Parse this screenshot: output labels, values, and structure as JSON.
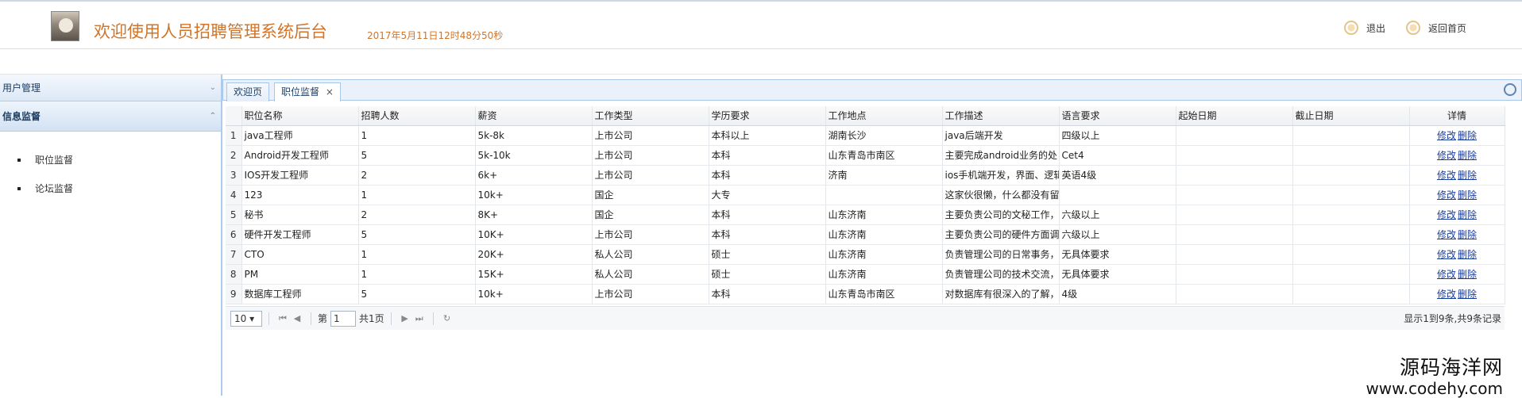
{
  "header": {
    "title": "欢迎使用人员招聘管理系统后台",
    "datetime": "2017年5月11日12时48分50秒",
    "logout_label": "退出",
    "home_label": "返回首页"
  },
  "sidebar": {
    "sections": [
      {
        "label": "用户管理"
      },
      {
        "label": "信息监督"
      }
    ],
    "items": [
      {
        "label": "职位监督"
      },
      {
        "label": "论坛监督"
      }
    ]
  },
  "tabs": [
    {
      "label": "欢迎页"
    },
    {
      "label": "职位监督",
      "close": "×"
    }
  ],
  "table": {
    "columns": [
      "职位名称",
      "招聘人数",
      "薪资",
      "工作类型",
      "学历要求",
      "工作地点",
      "工作描述",
      "语言要求",
      "起始日期",
      "截止日期",
      "详情"
    ],
    "rows": [
      [
        "1",
        "java工程师",
        "1",
        "5k-8k",
        "上市公司",
        "本科以上",
        "湖南长沙",
        "java后端开发",
        "四级以上",
        "",
        ""
      ],
      [
        "2",
        "Android开发工程师",
        "5",
        "5k-10k",
        "上市公司",
        "本科",
        "山东青岛市南区",
        "主要完成android业务的处",
        "Cet4",
        "",
        ""
      ],
      [
        "3",
        "IOS开发工程师",
        "2",
        "6k+",
        "上市公司",
        "本科",
        "济南",
        "ios手机端开发，界面、逻辑",
        "英语4级",
        "",
        ""
      ],
      [
        "4",
        "123",
        "1",
        "10k+",
        "国企",
        "大专",
        "",
        "这家伙很懒，什么都没有留",
        "",
        "",
        ""
      ],
      [
        "5",
        "秘书",
        "2",
        "8K+",
        "国企",
        "本科",
        "山东济南",
        "主要负责公司的文秘工作，",
        "六级以上",
        "",
        ""
      ],
      [
        "6",
        "硬件开发工程师",
        "5",
        "10K+",
        "上市公司",
        "本科",
        "山东济南",
        "主要负责公司的硬件方面调",
        "六级以上",
        "",
        ""
      ],
      [
        "7",
        "CTO",
        "1",
        "20K+",
        "私人公司",
        "硕士",
        "山东济南",
        "负责管理公司的日常事务，",
        "无具体要求",
        "",
        ""
      ],
      [
        "8",
        "PM",
        "1",
        "15K+",
        "私人公司",
        "硕士",
        "山东济南",
        "负责管理公司的技术交流，",
        "无具体要求",
        "",
        ""
      ],
      [
        "9",
        "数据库工程师",
        "5",
        "10k+",
        "上市公司",
        "本科",
        "山东青岛市南区",
        "对数据库有很深入的了解，",
        "4级",
        "",
        ""
      ]
    ],
    "edit_label": "修改",
    "delete_label": "删除"
  },
  "pager": {
    "page_size": "10",
    "page_prefix": "第",
    "page_value": "1",
    "page_total": "共1页",
    "info": "显示1到9条,共9条记录"
  },
  "watermark": {
    "cn": "源码海洋网",
    "en": "www.codehy.com"
  }
}
